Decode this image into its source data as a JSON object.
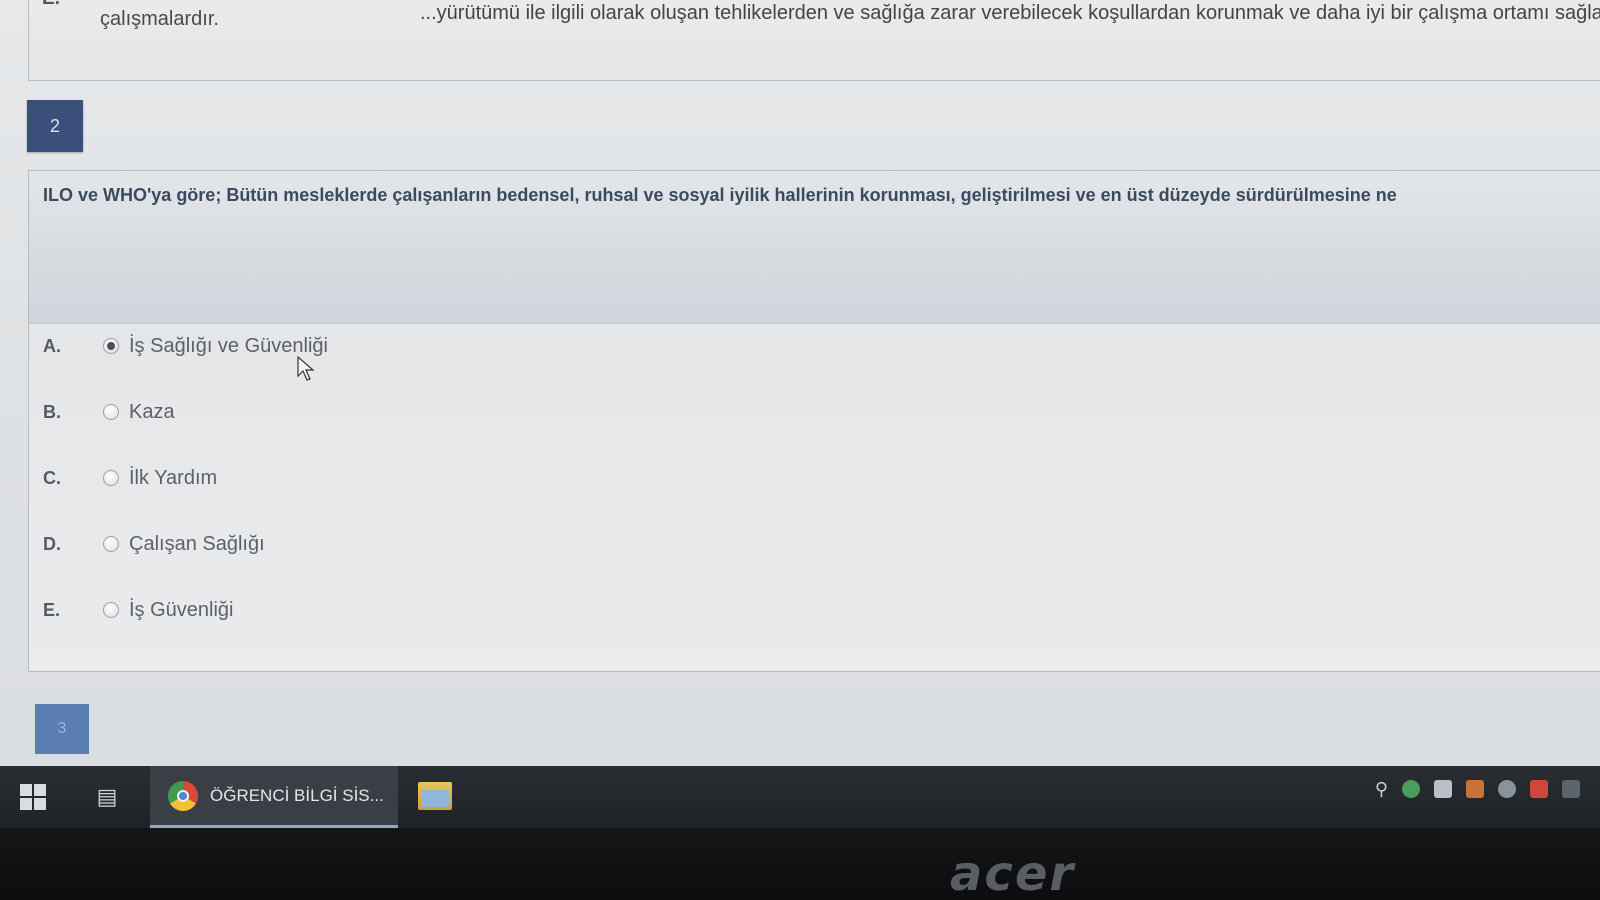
{
  "previous_question": {
    "option_letter": "E.",
    "text_line1": "...yürütümü ile ilgili olarak oluşan tehlikelerden ve sağlığa zarar verebilecek koşullardan korunmak ve daha iyi bir çalışma ortamı sağla",
    "text_line2": "çalışmalardır."
  },
  "question": {
    "number": "2",
    "text": "ILO ve WHO'ya göre; Bütün mesleklerde çalışanların bedensel, ruhsal ve sosyal iyilik hallerinin korunması, geliştirilmesi ve en üst düzeyde sürdürülmesine ne",
    "options": [
      {
        "letter": "A.",
        "label": "İş Sağlığı ve Güvenliği",
        "selected": true
      },
      {
        "letter": "B.",
        "label": "Kaza",
        "selected": false
      },
      {
        "letter": "C.",
        "label": "İlk Yardım",
        "selected": false
      },
      {
        "letter": "D.",
        "label": "Çalışan Sağlığı",
        "selected": false
      },
      {
        "letter": "E.",
        "label": "İş Güvenliği",
        "selected": false
      }
    ]
  },
  "next_question": {
    "number": "3"
  },
  "taskbar": {
    "start_icon": "windows-start-icon",
    "taskview_icon": "task-view-icon",
    "active_app_label": "ÖĞRENCİ BİLGİ SİS...",
    "active_app_icon": "chrome-icon",
    "pinned_icon": "file-explorer-icon",
    "tray_icons": [
      "people-icon",
      "chrome-tray-icon",
      "network-icon",
      "app-tray-icon",
      "sync-icon",
      "tool-icon",
      "notification-icon"
    ]
  },
  "monitor": {
    "brand": "acer"
  }
}
